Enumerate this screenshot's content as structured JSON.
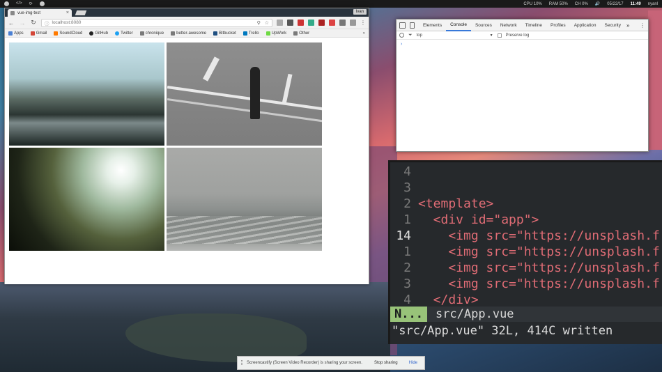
{
  "topbar": {
    "left_icons": [
      "menu-icon",
      "code-icon",
      "refresh-icon",
      "app-icon"
    ],
    "cpu": "CPU 10%",
    "ram": "RAM 50%",
    "ch": "CH 0%",
    "date": "05/22/17",
    "time": "11:49",
    "user": "nyanl"
  },
  "browser": {
    "tab_title": "vue-img-test",
    "profile": "Ivan",
    "url": "localhost:8080",
    "bookmarks": [
      {
        "label": "Apps",
        "color": "#4a80d4"
      },
      {
        "label": "Gmail",
        "color": "#d44638"
      },
      {
        "label": "SoundCloud",
        "color": "#ff7a00"
      },
      {
        "label": "GitHub",
        "color": "#222222"
      },
      {
        "label": "Twitter",
        "color": "#1da1f2"
      },
      {
        "label": "chronique",
        "color": "#7a7a7a"
      },
      {
        "label": "better-awesome",
        "color": "#7a7a7a"
      },
      {
        "label": "Bitbucket",
        "color": "#205081"
      },
      {
        "label": "Trello",
        "color": "#0079bf"
      },
      {
        "label": "UpWork",
        "color": "#6fda44"
      },
      {
        "label": "Other",
        "color": "#7a7a7a"
      }
    ],
    "more": "»"
  },
  "devtools": {
    "tabs": [
      "Elements",
      "Console",
      "Sources",
      "Network",
      "Timeline",
      "Profiles",
      "Application",
      "Security"
    ],
    "active_tab": "Console",
    "context": "top",
    "preserve_log": "Preserve log",
    "prompt": "›"
  },
  "terminal": {
    "lines": [
      {
        "num": "4",
        "code": ""
      },
      {
        "num": "3",
        "code": ""
      },
      {
        "num": "2",
        "code": "<template>"
      },
      {
        "num": "1",
        "code": "  <div id=\"app\">"
      },
      {
        "num": "14",
        "code": "    <img src=\"https://unsplash.f"
      },
      {
        "num": "1",
        "code": "    <img src=\"https://unsplash.f"
      },
      {
        "num": "2",
        "code": "    <img src=\"https://unsplash.f"
      },
      {
        "num": "3",
        "code": "    <img src=\"https://unsplash.f"
      },
      {
        "num": "4",
        "code": "  </div>"
      }
    ],
    "mode": "N...",
    "filename": "src/App.vue",
    "cmdline": "\"src/App.vue\" 32L, 414C written"
  },
  "sharebar": {
    "message": "Screencastify (Screen Video Recorder) is sharing your screen.",
    "stop": "Stop sharing",
    "hide": "Hide"
  }
}
